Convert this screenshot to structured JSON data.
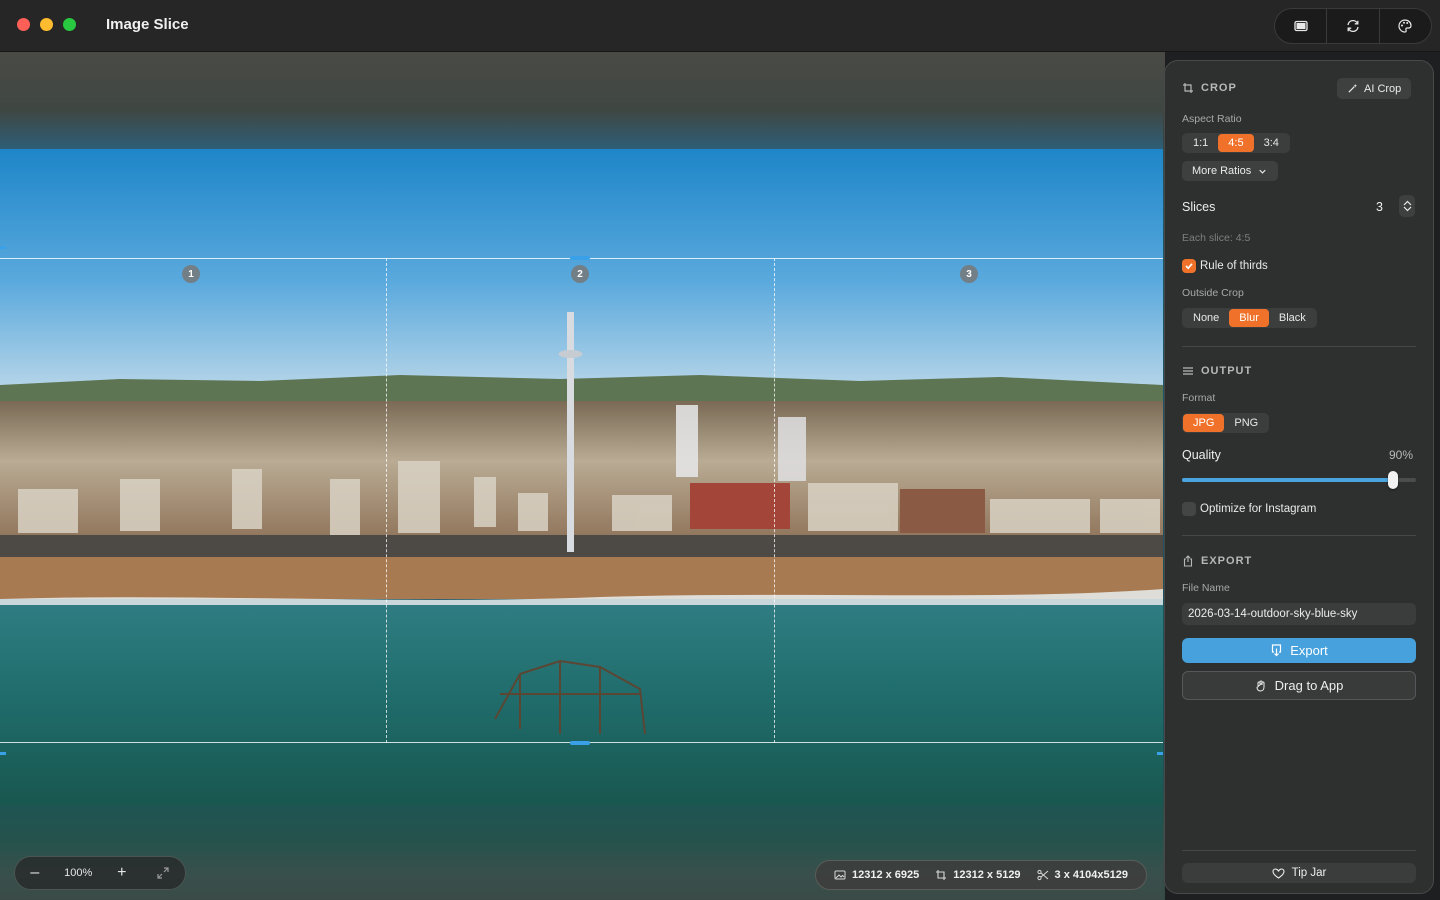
{
  "app": {
    "title": "Image Slice"
  },
  "toolbar": {
    "icons": [
      "window-icon",
      "refresh-icon",
      "palette-icon"
    ]
  },
  "canvas": {
    "slice_numbers": [
      "1",
      "2",
      "3"
    ],
    "zoom": {
      "minus": "–",
      "value": "100%",
      "plus": "+"
    },
    "info": {
      "original": "12312 x 6925",
      "crop": "12312 x 5129",
      "slices": "3 x 4104x5129"
    }
  },
  "panel": {
    "crop": {
      "title": "CROP",
      "ai_crop": "AI Crop",
      "aspect_label": "Aspect Ratio",
      "ratios": [
        "1:1",
        "4:5",
        "3:4"
      ],
      "active_ratio": "4:5",
      "more_ratios": "More Ratios",
      "slices_label": "Slices",
      "slices_value": "3",
      "each_slice": "Each slice: 4:5",
      "rule_of_thirds": "Rule of thirds",
      "rule_of_thirds_checked": true,
      "outside_label": "Outside Crop",
      "outside_options": [
        "None",
        "Blur",
        "Black"
      ],
      "outside_active": "Blur"
    },
    "output": {
      "title": "OUTPUT",
      "format_label": "Format",
      "formats": [
        "JPG",
        "PNG"
      ],
      "format_active": "JPG",
      "quality_label": "Quality",
      "quality_value": "90%",
      "quality_fraction": 0.9,
      "optimize_label": "Optimize for Instagram",
      "optimize_checked": false
    },
    "export": {
      "title": "EXPORT",
      "filename_label": "File Name",
      "filename": "2026-03-14-outdoor-sky-blue-sky",
      "export_btn": "Export",
      "drag_btn": "Drag to App",
      "tip_jar": "Tip Jar"
    }
  },
  "colors": {
    "accent_orange": "#f0722a",
    "accent_blue": "#47a1dd"
  }
}
